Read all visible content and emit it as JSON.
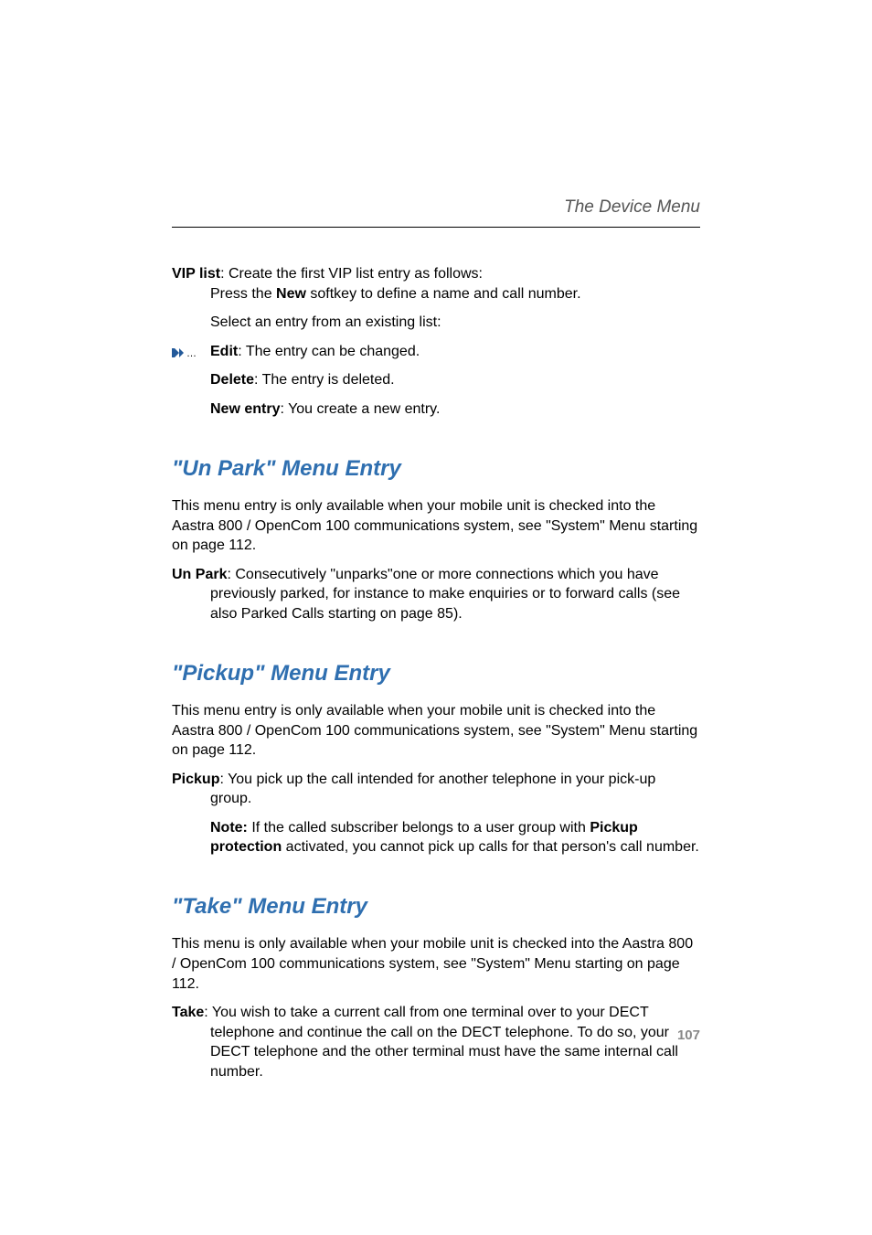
{
  "running_head": "The Device Menu",
  "vip": {
    "label": "VIP list",
    "desc": ": Create the first VIP list entry as follows:",
    "press_a": "Press the ",
    "new": "New",
    "press_b": " softkey to define a name and call number.",
    "select": "Select an entry from an existing list:",
    "edit_label": "Edit",
    "edit_desc": ": The entry can be changed.",
    "delete_label": "Delete",
    "delete_desc": ": The entry is deleted.",
    "newentry_label": "New entry",
    "newentry_desc": ": You create a new entry."
  },
  "unpark": {
    "heading": "\"Un Park\" Menu Entry",
    "intro": "This menu entry is only available when your mobile unit is checked into the Aastra 800 / OpenCom 100 communications system, see \"System\" Menu starting on page 112.",
    "label": "Un Park",
    "desc": ": Consecutively \"unparks\"one or more connections which you have previously parked, for instance to make enquiries or to forward calls (see also Parked Calls starting on page 85)."
  },
  "pickup": {
    "heading": "\"Pickup\" Menu Entry",
    "intro": "This menu entry is only available when your mobile unit is checked into the Aastra 800 / OpenCom 100 communications system, see \"System\" Menu starting on page 112.",
    "label": "Pickup",
    "desc": ": You pick up the call intended for another telephone in your pick-up group.",
    "note_label": "Note:",
    "note_a": " If the called subscriber belongs to a user group with ",
    "note_strong": "Pickup protection",
    "note_b": " activated, you cannot pick up calls for that person's call number."
  },
  "take": {
    "heading": "\"Take\" Menu Entry",
    "intro": "This menu is only available when your mobile unit is checked into the Aastra 800 / OpenCom 100 communications system, see \"System\" Menu starting on page 112.",
    "label": "Take",
    "desc": ": You wish to take a current call from one terminal over to your DECT telephone and continue the call on the DECT telephone. To do so, your DECT telephone and the other terminal must have the same internal call number."
  },
  "page_number": "107"
}
